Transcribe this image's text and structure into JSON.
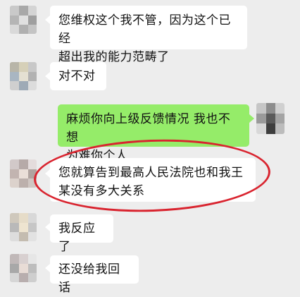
{
  "chat": {
    "messages": [
      {
        "side": "left",
        "lines": [
          "您维权这个我不管，因为这个已经",
          "超出我的能力范畴了"
        ]
      },
      {
        "side": "left",
        "lines": [
          "对不对"
        ]
      },
      {
        "side": "right",
        "lines": [
          "麻烦你向上级反馈情况 我也不想",
          "为难你个人"
        ]
      },
      {
        "side": "left",
        "lines": [
          "您就算告到最高人民法院也和我王",
          "某没有多大关系"
        ]
      },
      {
        "side": "left",
        "lines": [
          "我反应了"
        ]
      },
      {
        "side": "left",
        "lines": [
          "还没给我回话"
        ]
      }
    ]
  },
  "colors": {
    "background": "#ededed",
    "incoming_bubble": "#ffffff",
    "outgoing_bubble": "#95ec69",
    "highlight_circle": "#d9242f"
  },
  "icons": {
    "avatar": "blurred-avatar-icon"
  }
}
